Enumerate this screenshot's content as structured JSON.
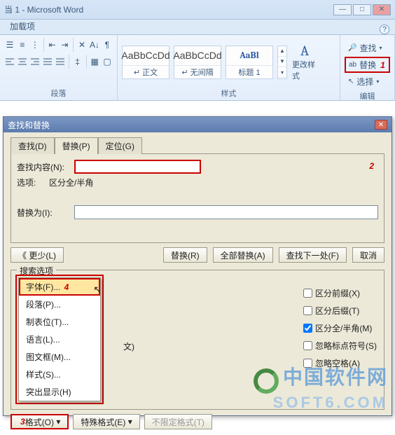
{
  "titlebar": {
    "text": "当 1 - Microsoft Word"
  },
  "ribbon_tab": "加载项",
  "groups": {
    "paragraph": {
      "label": "段落"
    },
    "styles": {
      "label": "样式",
      "change_label": "更改样式",
      "cards": [
        {
          "preview": "AaBbCcDd",
          "name": "↵ 正文"
        },
        {
          "preview": "AaBbCcDd",
          "name": "↵ 无间隔"
        },
        {
          "preview": "AaBl",
          "name": "标题 1"
        }
      ]
    },
    "edit": {
      "label": "编辑",
      "find": "查找",
      "replace": "替换",
      "select": "选择",
      "marker1": "1"
    }
  },
  "dialog": {
    "title": "查找和替换",
    "tabs": {
      "find": "查找(D)",
      "replace": "替换(P)",
      "goto": "定位(G)"
    },
    "find_label": "查找内容(N):",
    "options_label": "选项:",
    "options_value": "区分全/半角",
    "replace_label": "替换为(I):",
    "marker2": "2",
    "buttons": {
      "less": "《 更少(L)",
      "replace": "替换(R)",
      "replace_all": "全部替换(A)",
      "find_next": "查找下一处(F)",
      "cancel": "取消"
    },
    "search_options_legend": "搜索选项",
    "checkboxes": {
      "prefix": "区分前缀(X)",
      "suffix": "区分后缀(T)",
      "fullhalf": "区分全/半角(M)",
      "punct": "忽略标点符号(S)",
      "space": "忽略空格(A)"
    },
    "format_menu": {
      "font": "字体(F)...",
      "paragraph": "段落(P)...",
      "tabs": "制表位(T)...",
      "language": "语言(L)...",
      "frame": "图文框(M)...",
      "style": "样式(S)...",
      "highlight": "突出显示(H)"
    },
    "marker4": "4",
    "bottom": {
      "format": "格式(O)",
      "special": "特殊格式(E)",
      "noformat": "不限定格式(T)",
      "marker3": "3"
    }
  },
  "watermark": {
    "cn": "中国软件网",
    "en": "SOFT6.COM"
  }
}
